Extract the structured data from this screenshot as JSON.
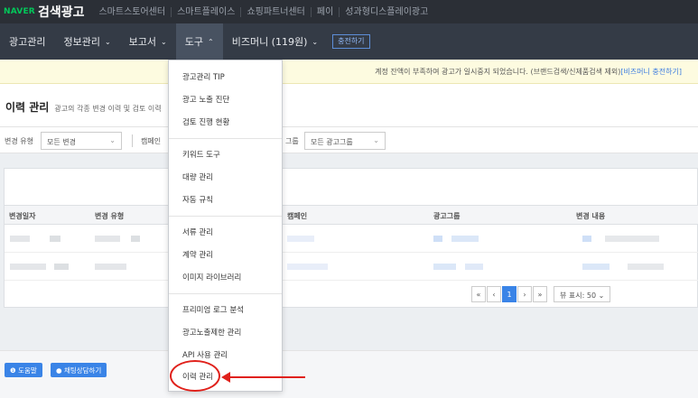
{
  "topbar": {
    "brand_naver": "NAVER",
    "brand_title": "검색광고",
    "links": [
      "스마트스토어센터",
      "스마트플레이스",
      "쇼핑파트너센터",
      "페이",
      "성과형디스플레이광고"
    ]
  },
  "nav": {
    "items": [
      {
        "label": "광고관리",
        "chevron": ""
      },
      {
        "label": "정보관리",
        "chevron": "⌄"
      },
      {
        "label": "보고서",
        "chevron": "⌄"
      },
      {
        "label": "도구",
        "chevron": "⌃"
      },
      {
        "label": "비즈머니 (119원)",
        "chevron": "⌄"
      }
    ],
    "charge_label": "충전하기"
  },
  "notice": {
    "text": "계정 잔액이 부족하여 광고가 일시중지 되었습니다. (브랜드검색/신제품검색 제외)",
    "link": "[비즈머니 충전하기]"
  },
  "page": {
    "title": "이력 관리",
    "subtitle": "광고의 각종 변경 이력 및 검토 이력"
  },
  "filters": {
    "change_type_label": "변경 유형",
    "change_type_value": "모든 변경",
    "campaign_label": "캠페인",
    "adgroup_label": "그룹",
    "adgroup_value": "모든 광고그룹"
  },
  "table": {
    "columns": [
      "변경일자",
      "변경 유형",
      "캠페인",
      "광고그룹",
      "변경 내용"
    ]
  },
  "pagination": {
    "first": "«",
    "prev": "‹",
    "current": "1",
    "next": "›",
    "last": "»",
    "view_label": "뷰 표시: 50",
    "view_chevron": "⌄"
  },
  "bottom": {
    "help_label": "도움말",
    "chat_label": "채팅상담하기"
  },
  "dropdown": {
    "items": [
      "광고관리 TIP",
      "광고 노출 진단",
      "검토 진행 현황",
      "키워드 도구",
      "대량 관리",
      "자동 규칙",
      "서류 관리",
      "계약 관리",
      "이미지 라이브러리",
      "프리미엄 로그 분석",
      "광고노출제한 관리",
      "API 사용 관리",
      "이력 관리"
    ]
  },
  "colors": {
    "topbar_bg": "#2b2f36",
    "nav_bg": "#343b46",
    "brand_green": "#03c75a",
    "accent_blue": "#3a84e7",
    "annotation_red": "#e0211b"
  },
  "icons": {
    "help": "info-circle-icon",
    "chat": "chat-bubble-icon"
  }
}
